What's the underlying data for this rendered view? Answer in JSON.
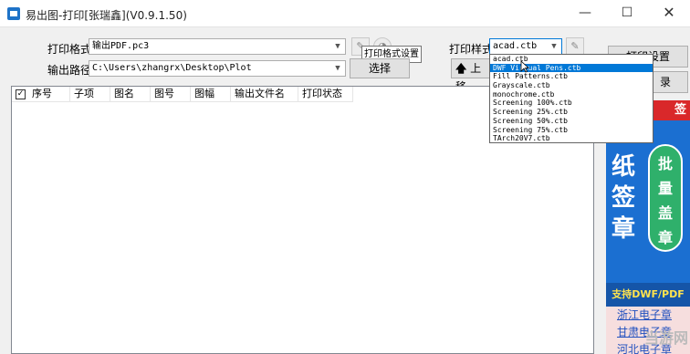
{
  "window": {
    "title": "易出图-打印[张瑞鑫](V0.9.1.50)",
    "minimize_glyph": "—",
    "maximize_glyph": "☐",
    "close_glyph": "✕"
  },
  "form": {
    "print_format_label": "打印格式",
    "print_format_value": "输出PDF.pc3",
    "output_path_label": "输出路径",
    "output_path_value": "C:\\Users\\zhangrx\\Desktop\\Plot",
    "select_button": "选择",
    "print_style_label": "打印样式",
    "print_style_value": "acad.ctb",
    "move_up_button": "上移",
    "tooltip": "打印格式设置"
  },
  "dropdown": {
    "options": [
      "acad.ctb",
      "DWF Virtual Pens.ctb",
      "Fill Patterns.ctb",
      "Grayscale.ctb",
      "monochrome.ctb",
      "Screening 100%.ctb",
      "Screening 25%.ctb",
      "Screening 50%.ctb",
      "Screening 75%.ctb",
      "TArch20V7.ctb"
    ],
    "highlighted_index": 1
  },
  "table": {
    "columns": [
      "序号",
      "子项",
      "图名",
      "图号",
      "图幅",
      "输出文件名",
      "打印状态"
    ]
  },
  "right_panel": {
    "print_settings_button": "打印设置",
    "record_button_partial": "录"
  },
  "ad": {
    "top_text": "签",
    "big_chars": [
      "纸",
      "签",
      "章"
    ],
    "pill_chars": [
      "批",
      "量",
      "盖",
      "章"
    ],
    "footer": "支持DWF/PDF",
    "links": [
      "浙江电子章",
      "甘肃电子章",
      "河北电子章"
    ]
  },
  "watermark": "当游网",
  "colors": {
    "selection": "#0078d7",
    "ad_blue": "#1b6fd1",
    "ad_red": "#d9282a",
    "ad_green": "#2fb06b",
    "link": "#1f4fbf"
  }
}
